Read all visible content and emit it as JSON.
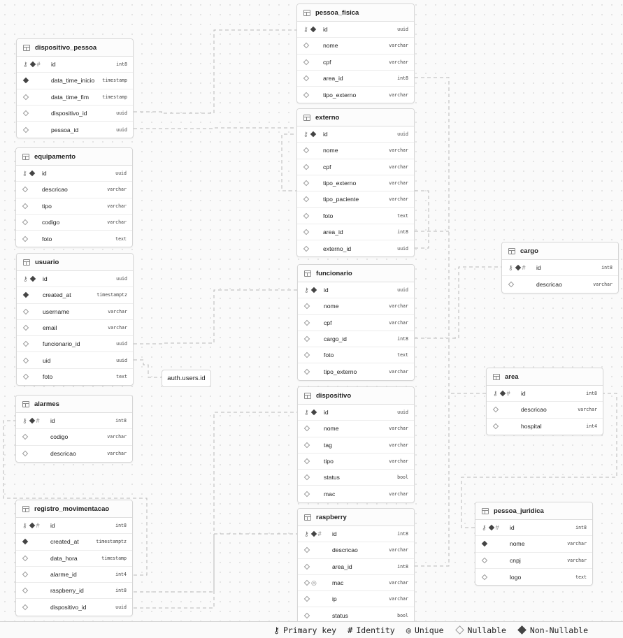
{
  "tables": [
    {
      "key": "dispositivo_pessoa",
      "name": "dispositivo_pessoa",
      "columns": [
        {
          "name": "id",
          "type": "int8",
          "flags": [
            "pk",
            "nn",
            "id"
          ]
        },
        {
          "name": "data_time_inicio",
          "type": "timestamp",
          "flags": [
            "nn"
          ]
        },
        {
          "name": "data_time_fim",
          "type": "timestamp",
          "flags": [
            "nl"
          ]
        },
        {
          "name": "dispositivo_id",
          "type": "uuid",
          "flags": [
            "nl"
          ]
        },
        {
          "name": "pessoa_id",
          "type": "uuid",
          "flags": [
            "nl"
          ]
        }
      ]
    },
    {
      "key": "equipamento",
      "name": "equipamento",
      "columns": [
        {
          "name": "id",
          "type": "uuid",
          "flags": [
            "pk",
            "nn"
          ]
        },
        {
          "name": "descricao",
          "type": "varchar",
          "flags": [
            "nl"
          ]
        },
        {
          "name": "tipo",
          "type": "varchar",
          "flags": [
            "nl"
          ]
        },
        {
          "name": "codigo",
          "type": "varchar",
          "flags": [
            "nl"
          ]
        },
        {
          "name": "foto",
          "type": "text",
          "flags": [
            "nl"
          ]
        }
      ]
    },
    {
      "key": "usuario",
      "name": "usuario",
      "columns": [
        {
          "name": "id",
          "type": "uuid",
          "flags": [
            "pk",
            "nn"
          ]
        },
        {
          "name": "created_at",
          "type": "timestamptz",
          "flags": [
            "nn"
          ]
        },
        {
          "name": "username",
          "type": "varchar",
          "flags": [
            "nl"
          ]
        },
        {
          "name": "email",
          "type": "varchar",
          "flags": [
            "nl"
          ]
        },
        {
          "name": "funcionario_id",
          "type": "uuid",
          "flags": [
            "nl"
          ]
        },
        {
          "name": "uid",
          "type": "uuid",
          "flags": [
            "nl"
          ]
        },
        {
          "name": "foto",
          "type": "text",
          "flags": [
            "nl"
          ]
        }
      ]
    },
    {
      "key": "alarmes",
      "name": "alarmes",
      "columns": [
        {
          "name": "id",
          "type": "int8",
          "flags": [
            "pk",
            "nn",
            "id"
          ]
        },
        {
          "name": "codigo",
          "type": "varchar",
          "flags": [
            "nl"
          ]
        },
        {
          "name": "descricao",
          "type": "varchar",
          "flags": [
            "nl"
          ]
        }
      ]
    },
    {
      "key": "registro_movimentacao",
      "name": "registro_movimentacao",
      "columns": [
        {
          "name": "id",
          "type": "int8",
          "flags": [
            "pk",
            "nn",
            "id"
          ]
        },
        {
          "name": "created_at",
          "type": "timestamptz",
          "flags": [
            "nn"
          ]
        },
        {
          "name": "data_hora",
          "type": "timestamp",
          "flags": [
            "nl"
          ]
        },
        {
          "name": "alarme_id",
          "type": "int4",
          "flags": [
            "nl"
          ]
        },
        {
          "name": "raspberry_id",
          "type": "int8",
          "flags": [
            "nl"
          ]
        },
        {
          "name": "dispositivo_id",
          "type": "uuid",
          "flags": [
            "nl"
          ]
        }
      ]
    },
    {
      "key": "pessoa_fisica",
      "name": "pessoa_fisica",
      "columns": [
        {
          "name": "id",
          "type": "uuid",
          "flags": [
            "pk",
            "nn"
          ]
        },
        {
          "name": "nome",
          "type": "varchar",
          "flags": [
            "nl"
          ]
        },
        {
          "name": "cpf",
          "type": "varchar",
          "flags": [
            "nl"
          ]
        },
        {
          "name": "area_id",
          "type": "int8",
          "flags": [
            "nl"
          ]
        },
        {
          "name": "tipo_externo",
          "type": "varchar",
          "flags": [
            "nl"
          ]
        }
      ]
    },
    {
      "key": "externo",
      "name": "externo",
      "columns": [
        {
          "name": "id",
          "type": "uuid",
          "flags": [
            "pk",
            "nn"
          ]
        },
        {
          "name": "nome",
          "type": "varchar",
          "flags": [
            "nl"
          ]
        },
        {
          "name": "cpf",
          "type": "varchar",
          "flags": [
            "nl"
          ]
        },
        {
          "name": "tipo_externo",
          "type": "varchar",
          "flags": [
            "nl"
          ]
        },
        {
          "name": "tipo_paciente",
          "type": "varchar",
          "flags": [
            "nl"
          ]
        },
        {
          "name": "foto",
          "type": "text",
          "flags": [
            "nl"
          ]
        },
        {
          "name": "area_id",
          "type": "int8",
          "flags": [
            "nl"
          ]
        },
        {
          "name": "externo_id",
          "type": "uuid",
          "flags": [
            "nl"
          ]
        }
      ]
    },
    {
      "key": "funcionario",
      "name": "funcionario",
      "columns": [
        {
          "name": "id",
          "type": "uuid",
          "flags": [
            "pk",
            "nn"
          ]
        },
        {
          "name": "nome",
          "type": "varchar",
          "flags": [
            "nl"
          ]
        },
        {
          "name": "cpf",
          "type": "varchar",
          "flags": [
            "nl"
          ]
        },
        {
          "name": "cargo_id",
          "type": "int8",
          "flags": [
            "nl"
          ]
        },
        {
          "name": "foto",
          "type": "text",
          "flags": [
            "nl"
          ]
        },
        {
          "name": "tipo_externo",
          "type": "varchar",
          "flags": [
            "nl"
          ]
        }
      ]
    },
    {
      "key": "dispositivo",
      "name": "dispositivo",
      "columns": [
        {
          "name": "id",
          "type": "uuid",
          "flags": [
            "pk",
            "nn"
          ]
        },
        {
          "name": "nome",
          "type": "varchar",
          "flags": [
            "nl"
          ]
        },
        {
          "name": "tag",
          "type": "varchar",
          "flags": [
            "nl"
          ]
        },
        {
          "name": "tipo",
          "type": "varchar",
          "flags": [
            "nl"
          ]
        },
        {
          "name": "status",
          "type": "bool",
          "flags": [
            "nl"
          ]
        },
        {
          "name": "mac",
          "type": "varchar",
          "flags": [
            "nl"
          ]
        }
      ]
    },
    {
      "key": "raspberry",
      "name": "raspberry",
      "columns": [
        {
          "name": "id",
          "type": "int8",
          "flags": [
            "pk",
            "nn",
            "id"
          ]
        },
        {
          "name": "descricao",
          "type": "varchar",
          "flags": [
            "nl"
          ]
        },
        {
          "name": "area_id",
          "type": "int8",
          "flags": [
            "nl"
          ]
        },
        {
          "name": "mac",
          "type": "varchar",
          "flags": [
            "nl",
            "un"
          ]
        },
        {
          "name": "ip",
          "type": "varchar",
          "flags": [
            "nl"
          ]
        },
        {
          "name": "status",
          "type": "bool",
          "flags": [
            "nl"
          ]
        }
      ]
    },
    {
      "key": "cargo",
      "name": "cargo",
      "columns": [
        {
          "name": "id",
          "type": "int8",
          "flags": [
            "pk",
            "nn",
            "id"
          ]
        },
        {
          "name": "descricao",
          "type": "varchar",
          "flags": [
            "nl"
          ]
        }
      ]
    },
    {
      "key": "area",
      "name": "area",
      "columns": [
        {
          "name": "id",
          "type": "int8",
          "flags": [
            "pk",
            "nn",
            "id"
          ]
        },
        {
          "name": "descricao",
          "type": "varchar",
          "flags": [
            "nl"
          ]
        },
        {
          "name": "hospital",
          "type": "int4",
          "flags": [
            "nl"
          ]
        }
      ]
    },
    {
      "key": "pessoa_juridica",
      "name": "pessoa_juridica",
      "columns": [
        {
          "name": "id",
          "type": "int8",
          "flags": [
            "pk",
            "nn",
            "id"
          ]
        },
        {
          "name": "nome",
          "type": "varchar",
          "flags": [
            "nn"
          ]
        },
        {
          "name": "cnpj",
          "type": "varchar",
          "flags": [
            "nl"
          ]
        },
        {
          "name": "logo",
          "type": "text",
          "flags": [
            "nl"
          ]
        }
      ]
    }
  ],
  "external_ref": {
    "label": "auth.users.id"
  },
  "legend": [
    {
      "key": "pk",
      "label": "Primary key"
    },
    {
      "key": "id",
      "label": "Identity"
    },
    {
      "key": "un",
      "label": "Unique"
    },
    {
      "key": "nl",
      "label": "Nullable"
    },
    {
      "key": "nn",
      "label": "Non-Nullable"
    }
  ],
  "colors": {
    "background": "#fafafa",
    "border": "#d6d6d6",
    "link": "#b8b8b8",
    "text": "#1f1f1f"
  }
}
